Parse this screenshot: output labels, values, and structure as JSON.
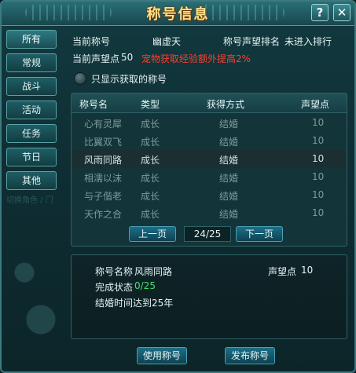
{
  "window": {
    "title": "称号信息",
    "help_label": "?",
    "close_label": "✕"
  },
  "sidebar": {
    "tabs": [
      {
        "label": "所有"
      },
      {
        "label": "常规"
      },
      {
        "label": "战斗"
      },
      {
        "label": "活动"
      },
      {
        "label": "任务"
      },
      {
        "label": "节日"
      },
      {
        "label": "其他"
      }
    ],
    "watermark": "切换角色 / 门"
  },
  "info": {
    "current_title_label": "当前称号",
    "current_title_value": "幽虚天",
    "rank_label": "称号声望排名",
    "rank_value": "未进入排行",
    "prestige_label": "当前声望点",
    "prestige_value": "50",
    "bonus_text": "宠物获取经验额外提高2%"
  },
  "filter": {
    "label": "只显示获取的称号"
  },
  "table": {
    "headers": [
      "称号名",
      "类型",
      "获得方式",
      "声望点"
    ],
    "rows": [
      {
        "name": "心有灵犀",
        "type": "成长",
        "method": "结婚",
        "points": "10"
      },
      {
        "name": "比翼双飞",
        "type": "成长",
        "method": "结婚",
        "points": "10"
      },
      {
        "name": "风雨同路",
        "type": "成长",
        "method": "结婚",
        "points": "10"
      },
      {
        "name": "相濡以沫",
        "type": "成长",
        "method": "结婚",
        "points": "10"
      },
      {
        "name": "与子偕老",
        "type": "成长",
        "method": "结婚",
        "points": "10"
      },
      {
        "name": "天作之合",
        "type": "成长",
        "method": "结婚",
        "points": "10"
      }
    ]
  },
  "pager": {
    "prev_label": "上一页",
    "page_text": "24/25",
    "next_label": "下一页"
  },
  "detail": {
    "name_label": "称号名称",
    "name_value": "风雨同路",
    "points_label": "声望点",
    "points_value": "10",
    "status_label": "完成状态",
    "status_value": "0/25",
    "requirement": "结婚时间达到25年"
  },
  "buttons": {
    "use_label": "使用称号",
    "publish_label": "发布称号"
  }
}
